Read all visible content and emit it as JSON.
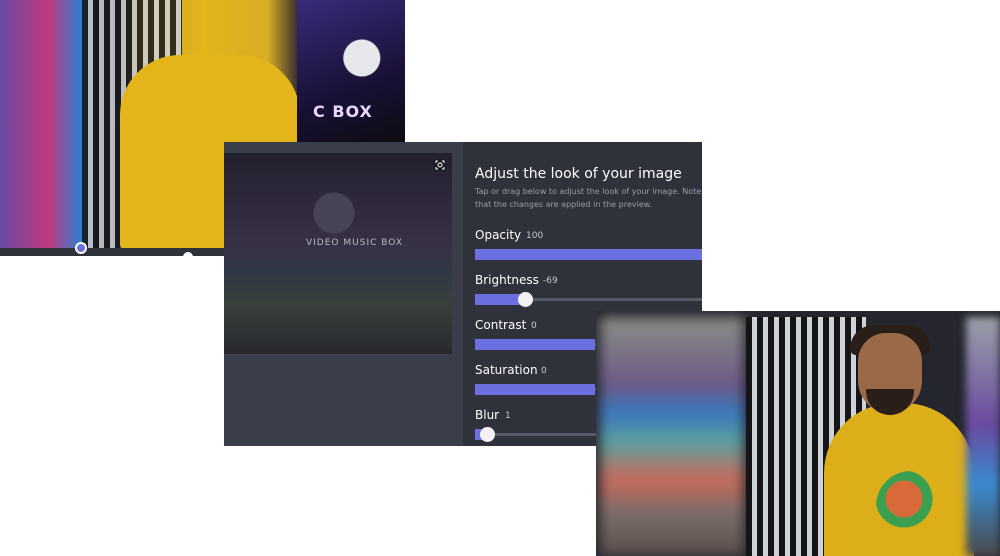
{
  "background_photo": {
    "poster_text": "C BOX"
  },
  "panel": {
    "title": "Adjust the look of your image",
    "description": "Tap or drag below to adjust the look of your image. Note that the changes are applied in the preview.",
    "thumbnail_label": "VIDEO MUSIC BOX",
    "expand_icon": "expand-icon",
    "sliders": [
      {
        "label": "Opacity",
        "value": "100",
        "fill": 1.0,
        "knob": false
      },
      {
        "label": "Brightness",
        "value": "-69",
        "fill": 0.21,
        "knob": true
      },
      {
        "label": "Contrast",
        "value": "0",
        "fill": 0.5,
        "knob": false
      },
      {
        "label": "Saturation",
        "value": "0",
        "fill": 0.5,
        "knob": false
      },
      {
        "label": "Blur",
        "value": "1",
        "fill": 0.05,
        "knob": true
      }
    ]
  },
  "colors": {
    "accent": "#6c6fe0",
    "panel_bg": "#2f313b",
    "track": "#575a68"
  }
}
